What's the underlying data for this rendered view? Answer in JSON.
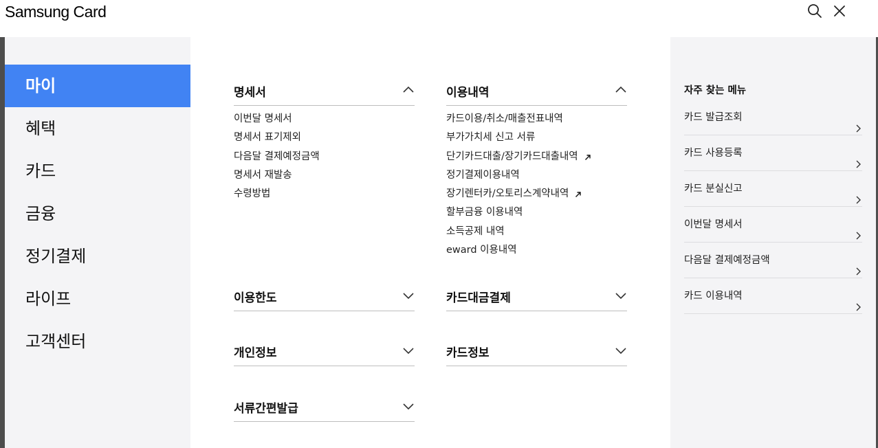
{
  "header": {
    "logo": "Samsung Card",
    "search_icon": "search-icon",
    "close_icon": "close-icon"
  },
  "sidebar": {
    "items": [
      {
        "label": "마이",
        "active": true
      },
      {
        "label": "혜택",
        "active": false
      },
      {
        "label": "카드",
        "active": false
      },
      {
        "label": "금융",
        "active": false
      },
      {
        "label": "정기결제",
        "active": false
      },
      {
        "label": "라이프",
        "active": false
      },
      {
        "label": "고객센터",
        "active": false
      }
    ]
  },
  "sections": [
    {
      "title": "명세서",
      "expanded": true,
      "items": [
        "이번달 명세서",
        "명세서 표기제외",
        "다음달 결제예정금액",
        "명세서 재발송",
        "수령방법"
      ]
    },
    {
      "title": "이용내역",
      "expanded": true,
      "items": [
        "카드이용/취소/매출전표내역",
        "부가가치세 신고 서류",
        "단기카드대출/장기카드대출내역",
        "정기결제이용내역",
        "장기렌터카/오토리스계약내역",
        "할부금융 이용내역",
        "소득공제 내역",
        "eward 이용내역"
      ],
      "external_items": [
        2,
        4
      ]
    },
    {
      "title": "이용한도",
      "expanded": false,
      "items": []
    },
    {
      "title": "카드대금결제",
      "expanded": false,
      "items": []
    },
    {
      "title": "개인정보",
      "expanded": false,
      "items": []
    },
    {
      "title": "카드정보",
      "expanded": false,
      "items": []
    },
    {
      "title": "서류간편발급",
      "expanded": false,
      "items": []
    }
  ],
  "quick_menu": {
    "title": "자주 찾는 메뉴",
    "items": [
      "카드 발급조회",
      "카드 사용등록",
      "카드 분실신고",
      "이번달 명세서",
      "다음달 결제예정금액",
      "카드 이용내역"
    ]
  },
  "colors": {
    "accent": "#4183f3",
    "sidebar_bg": "#f4f4f6",
    "edge": "#4d4d4d"
  }
}
